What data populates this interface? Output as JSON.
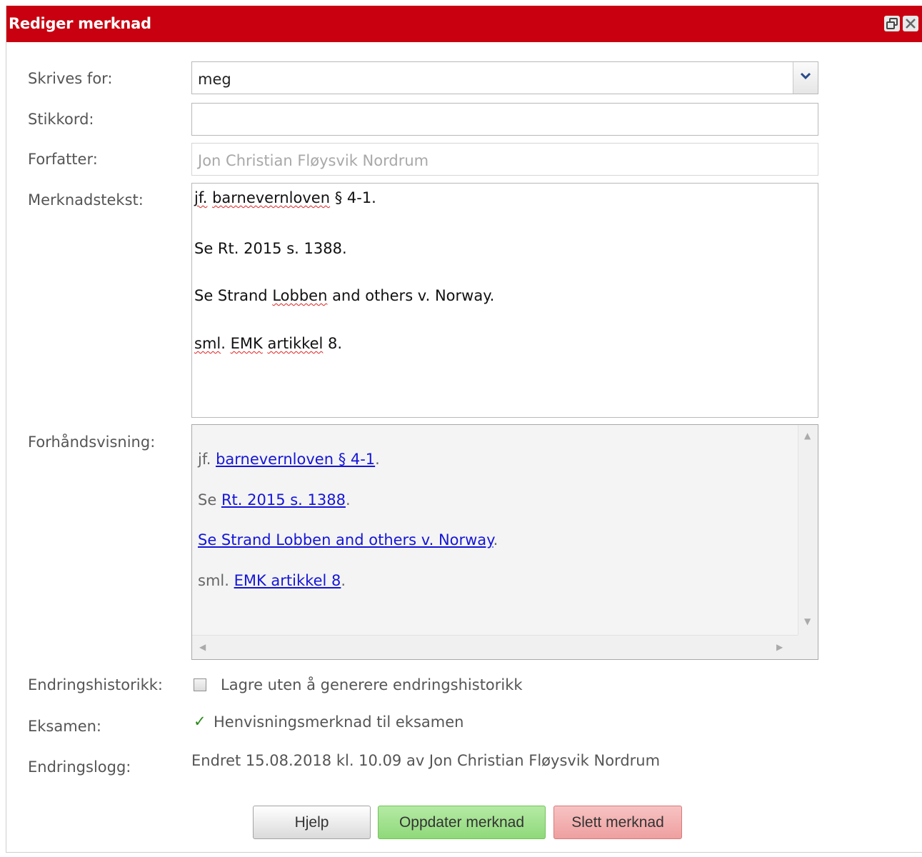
{
  "window": {
    "title": "Rediger merknad"
  },
  "form": {
    "skrives_for": {
      "label": "Skrives for:",
      "value": "meg"
    },
    "stikkord": {
      "label": "Stikkord:",
      "value": ""
    },
    "forfatter": {
      "label": "Forfatter:",
      "value": "Jon Christian Fløysvik Nordrum"
    },
    "merknadstekst": {
      "label": "Merknadstekst:",
      "lines": [
        {
          "pre": "",
          "sq1": "jf.",
          "mid": " ",
          "sq2": "barnevernloven",
          "post": " § 4-1."
        },
        {
          "text": "Se Rt. 2015 s. 1388."
        },
        {
          "pre": "Se Strand ",
          "sq": "Lobben",
          "post": " and others v. Norway."
        },
        {
          "sq1": "sml",
          "mid": ". ",
          "sq2": "EMK",
          "mid2": " ",
          "sq3": "artikkel",
          "post": " 8."
        }
      ]
    },
    "forhandsvisning": {
      "label": "Forhåndsvisning:",
      "lines": [
        {
          "prefix": "jf. ",
          "link": "barnevernloven § 4-1",
          "suffix": "."
        },
        {
          "prefix": "Se ",
          "link": "Rt. 2015 s. 1388",
          "suffix": "."
        },
        {
          "prefix": "",
          "link": "Se Strand Lobben and others v. Norway",
          "suffix": "."
        },
        {
          "prefix": "sml. ",
          "link": "EMK artikkel 8",
          "suffix": "."
        }
      ]
    },
    "endringshistorikk": {
      "label": "Endringshistorikk:",
      "checkbox_label": "Lagre uten å generere endringshistorikk",
      "checked": false
    },
    "eksamen": {
      "label": "Eksamen:",
      "value": "Henvisningsmerknad til eksamen",
      "check_glyph": "✓"
    },
    "endringslogg": {
      "label": "Endringslogg:",
      "value": "Endret 15.08.2018 kl. 10.09 av Jon Christian Fløysvik Nordrum"
    }
  },
  "buttons": {
    "help": "Hjelp",
    "update": "Oppdater merknad",
    "delete": "Slett merknad"
  },
  "colors": {
    "titlebar": "#c8000f",
    "link": "#1515d8",
    "check": "#2a8a1a"
  }
}
